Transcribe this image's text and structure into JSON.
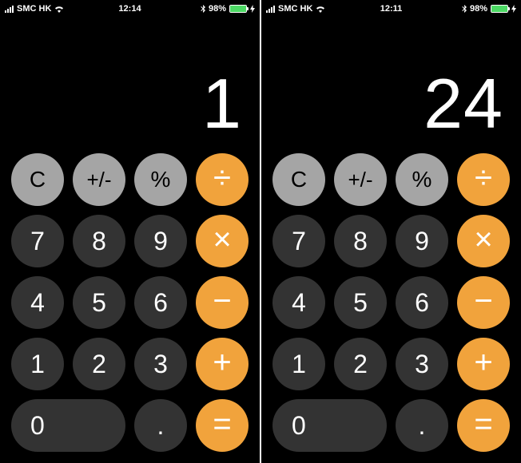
{
  "colors": {
    "orange": "#f1a33c",
    "lightKey": "#a5a5a5",
    "darkKey": "#333333",
    "bg": "#000000"
  },
  "screens": [
    {
      "status": {
        "carrier": "SMC HK",
        "time": "12:14",
        "battery_pct": "98%"
      },
      "display_value": "1"
    },
    {
      "status": {
        "carrier": "SMC HK",
        "time": "12:11",
        "battery_pct": "98%"
      },
      "display_value": "24"
    }
  ],
  "keypad": {
    "clear": "C",
    "sign": "+/-",
    "percent": "%",
    "divide": "÷",
    "multiply": "×",
    "minus": "−",
    "plus": "+",
    "equals": "=",
    "decimal": ".",
    "d0": "0",
    "d1": "1",
    "d2": "2",
    "d3": "3",
    "d4": "4",
    "d5": "5",
    "d6": "6",
    "d7": "7",
    "d8": "8",
    "d9": "9"
  }
}
